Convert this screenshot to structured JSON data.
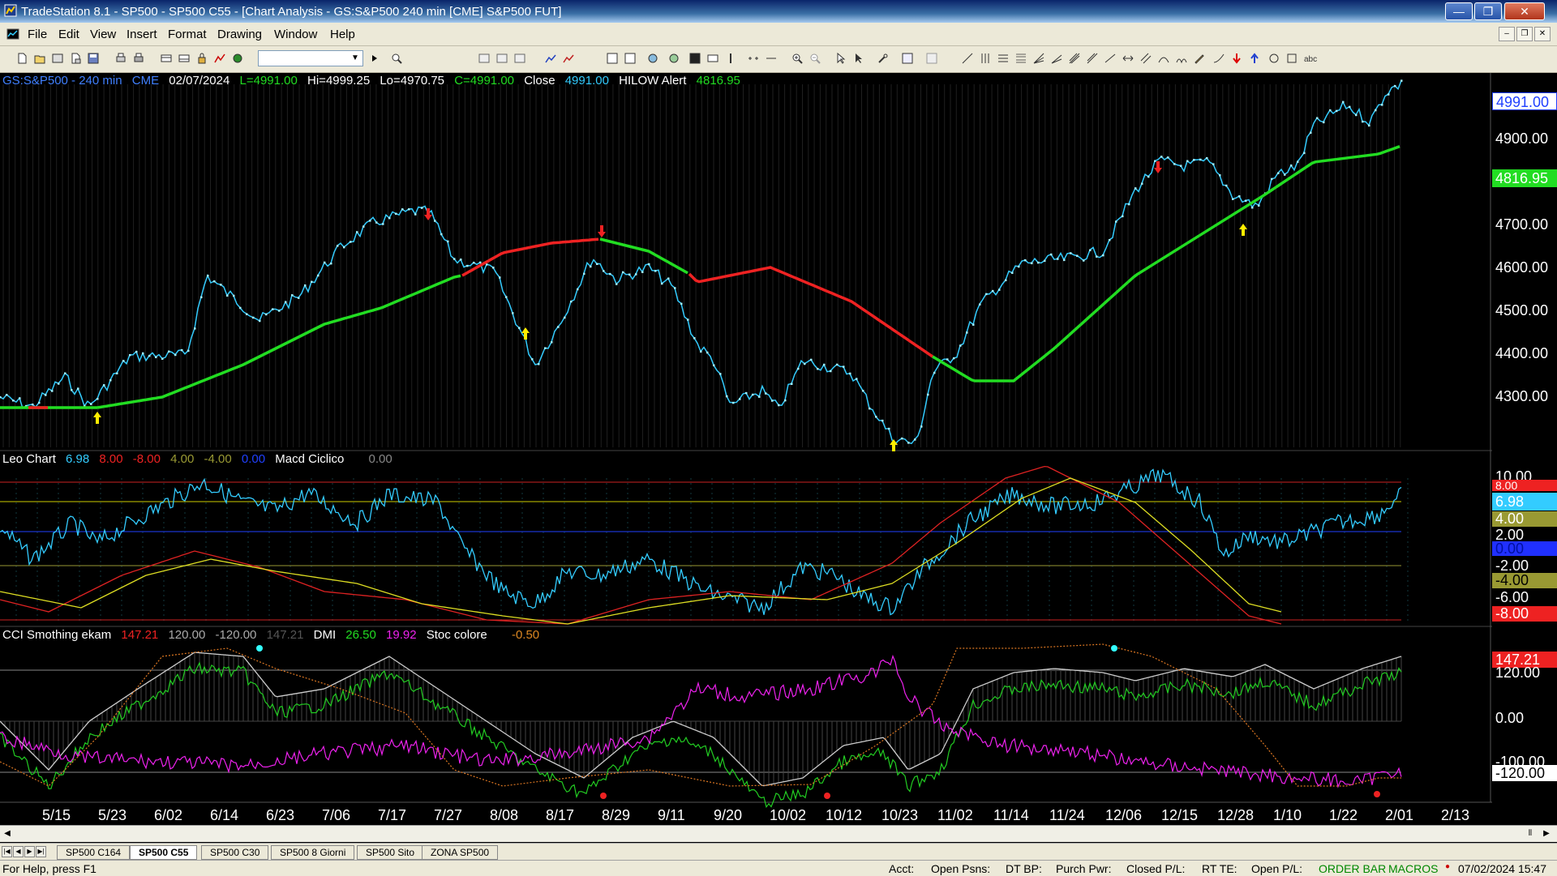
{
  "window": {
    "title": "TradeStation 8.1 - SP500 - SP500 C55 - [Chart Analysis - GS:S&P500  240 min  [CME] S&P500 FUT]",
    "minimize": "—",
    "maximize": "❐",
    "close": "✕"
  },
  "menu": {
    "items": [
      "File",
      "Edit",
      "View",
      "Insert",
      "Format",
      "Drawing",
      "Window",
      "Help"
    ],
    "mdi": [
      "–",
      "❐",
      "✕"
    ]
  },
  "toolbar": {
    "symbol_value": ""
  },
  "chart": {
    "header": {
      "symbol": "GS:S&P500 - 240 min",
      "exchange": "CME",
      "date": "02/07/2024",
      "last": "L=4991.00",
      "high": "Hi=4999.25",
      "low": "Lo=4970.75",
      "close_eq": "C=4991.00",
      "close_label": "Close",
      "close_value": "4991.00",
      "alert_label": "HILOW Alert",
      "alert_value": "4816.95"
    },
    "price_tags": {
      "last": "4991.00",
      "alert": "4816.95"
    },
    "price_axis": [
      "4900.00",
      "4800.00",
      "4700.00",
      "4600.00",
      "4500.00",
      "4400.00",
      "4300.00"
    ],
    "dates": [
      "5/15",
      "5/23",
      "6/02",
      "6/14",
      "6/23",
      "7/06",
      "7/17",
      "7/27",
      "8/08",
      "8/17",
      "8/29",
      "9/11",
      "9/20",
      "10/02",
      "10/12",
      "10/23",
      "11/02",
      "11/14",
      "11/24",
      "12/06",
      "12/15",
      "12/28",
      "1/10",
      "1/22",
      "2/01",
      "2/13"
    ],
    "leo": {
      "name": "Leo Chart",
      "v1": "6.98",
      "v2": "8.00",
      "v3": "-8.00",
      "v4": "4.00",
      "v5": "-4.00",
      "v6": "0.00",
      "macd_label": "Macd Ciclico",
      "macd_value": "0.00",
      "axis": [
        "10.00",
        "2.00",
        "-2.00",
        "-6.00"
      ],
      "tags": {
        "t1": "8.00",
        "t2": "6.98",
        "t3": "4.00",
        "t4": "0.00",
        "t5": "-4.00",
        "t6": "-8.00"
      }
    },
    "cci": {
      "name": "CCI Smothing ekam",
      "v1": "147.21",
      "v2": "120.00",
      "v3": "-120.00",
      "v4": "147.21",
      "dmi_label": "DMI",
      "dmi1": "26.50",
      "dmi2": "19.92",
      "stoc_label": "Stoc colore",
      "stoc_value": "-0.50",
      "axis": [
        "120.00",
        "0.00",
        "-100.00"
      ],
      "tags": {
        "t1": "147.21",
        "t2": "-120.00"
      }
    },
    "colors": {
      "price": "#33ccff",
      "ma_up": "#22dd22",
      "ma_down": "#ee2222",
      "arrow_up": "#ffee00",
      "arrow_down": "#ee2222"
    }
  },
  "tabs": [
    "SP500 C164",
    "SP500 C55",
    "SP500 C30",
    "SP500 8 Giorni",
    "SP500 Sito",
    "ZONA SP500"
  ],
  "status": {
    "help": "For Help, press F1",
    "acct": "Acct:",
    "open_psns": "Open Psns:",
    "dt_bp": "DT BP:",
    "purch_pwr": "Purch Pwr:",
    "closed_pl": "Closed P/L:",
    "rt_te": "RT TE:",
    "open_pl": "Open P/L:",
    "order_bar": "ORDER BAR",
    "macros": "MACROS",
    "datetime": "07/02/2024 15:47"
  }
}
